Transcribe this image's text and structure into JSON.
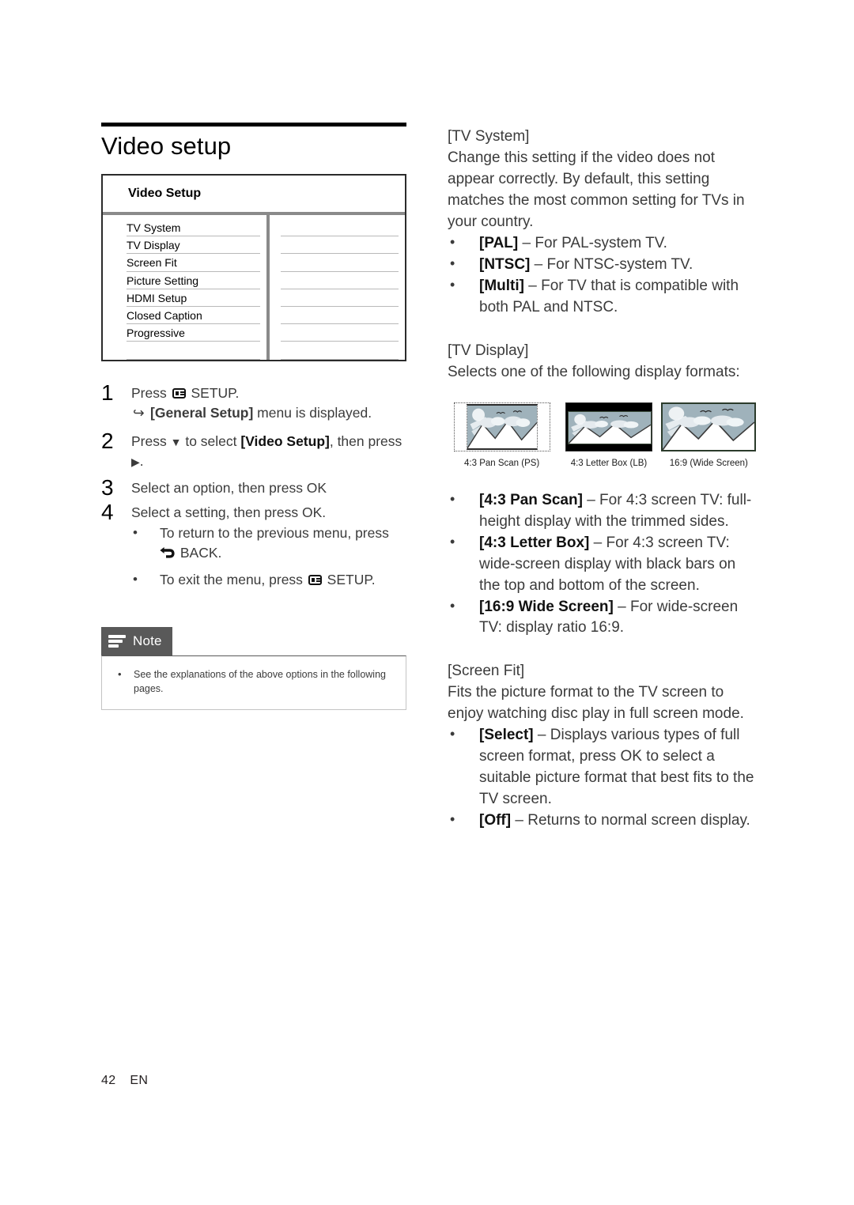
{
  "page": {
    "title": "Video setup",
    "footer_page_number": "42",
    "footer_language": "EN"
  },
  "setup_table": {
    "header": "Video Setup",
    "rows": [
      "TV System",
      "TV Display",
      "Screen Fit",
      "Picture Setting",
      "HDMI Setup",
      "Closed Caption",
      "Progressive"
    ],
    "values": [
      "",
      "",
      "",
      "",
      "",
      "",
      ""
    ]
  },
  "steps": [
    {
      "number": "1",
      "text_before_icon": "Press ",
      "icon": "setup-icon",
      "text_after_icon": " SETUP.",
      "sub_arrow": {
        "glyph": "↪",
        "bold": "[General Setup]",
        "rest": " menu is displayed."
      }
    },
    {
      "number": "2",
      "text_a": "Press ",
      "glyph_down": "▼",
      "text_b": " to select ",
      "bold": "[Video Setup]",
      "text_c": ", then press ",
      "glyph_right": "▶",
      "text_d": "."
    },
    {
      "number": "3",
      "text": "Select an option, then press OK"
    },
    {
      "number": "4",
      "text": "Select a setting, then press OK.",
      "bullets": [
        {
          "text_a": "To return to the previous menu, press ",
          "icon": "back-icon",
          "text_b": " BACK."
        },
        {
          "text_a": "To exit the menu, press ",
          "icon": "setup-icon",
          "text_b": " SETUP."
        }
      ]
    }
  ],
  "note": {
    "label": "Note",
    "icon": "note-lines-icon",
    "items": [
      "See the explanations of the above options in the following pages."
    ]
  },
  "sections": [
    {
      "id": "tv-system",
      "heading": "[TV System]",
      "paragraph": "Change this setting if the video does not appear correctly. By default, this setting matches the most common setting for TVs in your country.",
      "options": [
        {
          "bold": "[PAL]",
          "rest": " – For PAL-system TV."
        },
        {
          "bold": "[NTSC]",
          "rest": " – For NTSC-system TV."
        },
        {
          "bold": "[Multi]",
          "rest": " – For TV that is compatible with both PAL and NTSC."
        }
      ]
    },
    {
      "id": "tv-display",
      "heading": "[TV Display]",
      "paragraph": "Selects one of the following display formats:",
      "thumbnails": [
        {
          "id": "pan-scan",
          "caption": "4:3 Pan Scan (PS)"
        },
        {
          "id": "letter-box",
          "caption": "4:3 Letter Box (LB)"
        },
        {
          "id": "wide-screen",
          "caption": "16:9 (Wide Screen)"
        }
      ],
      "options": [
        {
          "bold": "[4:3 Pan Scan]",
          "rest": " – For 4:3 screen TV: full-height display with the trimmed sides."
        },
        {
          "bold": "[4:3 Letter Box]",
          "rest": " – For 4:3 screen TV: wide-screen display with black bars on the top and bottom of the screen."
        },
        {
          "bold": "[16:9 Wide Screen]",
          "rest": " – For wide-screen TV: display ratio 16:9."
        }
      ]
    },
    {
      "id": "screen-fit",
      "heading": "[Screen Fit]",
      "paragraph": "Fits the picture format to the TV screen to enjoy watching disc play in full screen mode.",
      "options": [
        {
          "bold": "[Select]",
          "rest": " – Displays various types of full screen format, press OK to select a suitable picture format that best fits to the TV screen."
        },
        {
          "bold": "[Off]",
          "rest": " – Returns to normal screen display."
        }
      ]
    }
  ],
  "colors": {
    "text": "#3b3b3b",
    "heading": "#000000",
    "note_tab_bg": "#595959",
    "table_divider": "#8a8a8a",
    "sky": "#9fb2bb"
  }
}
